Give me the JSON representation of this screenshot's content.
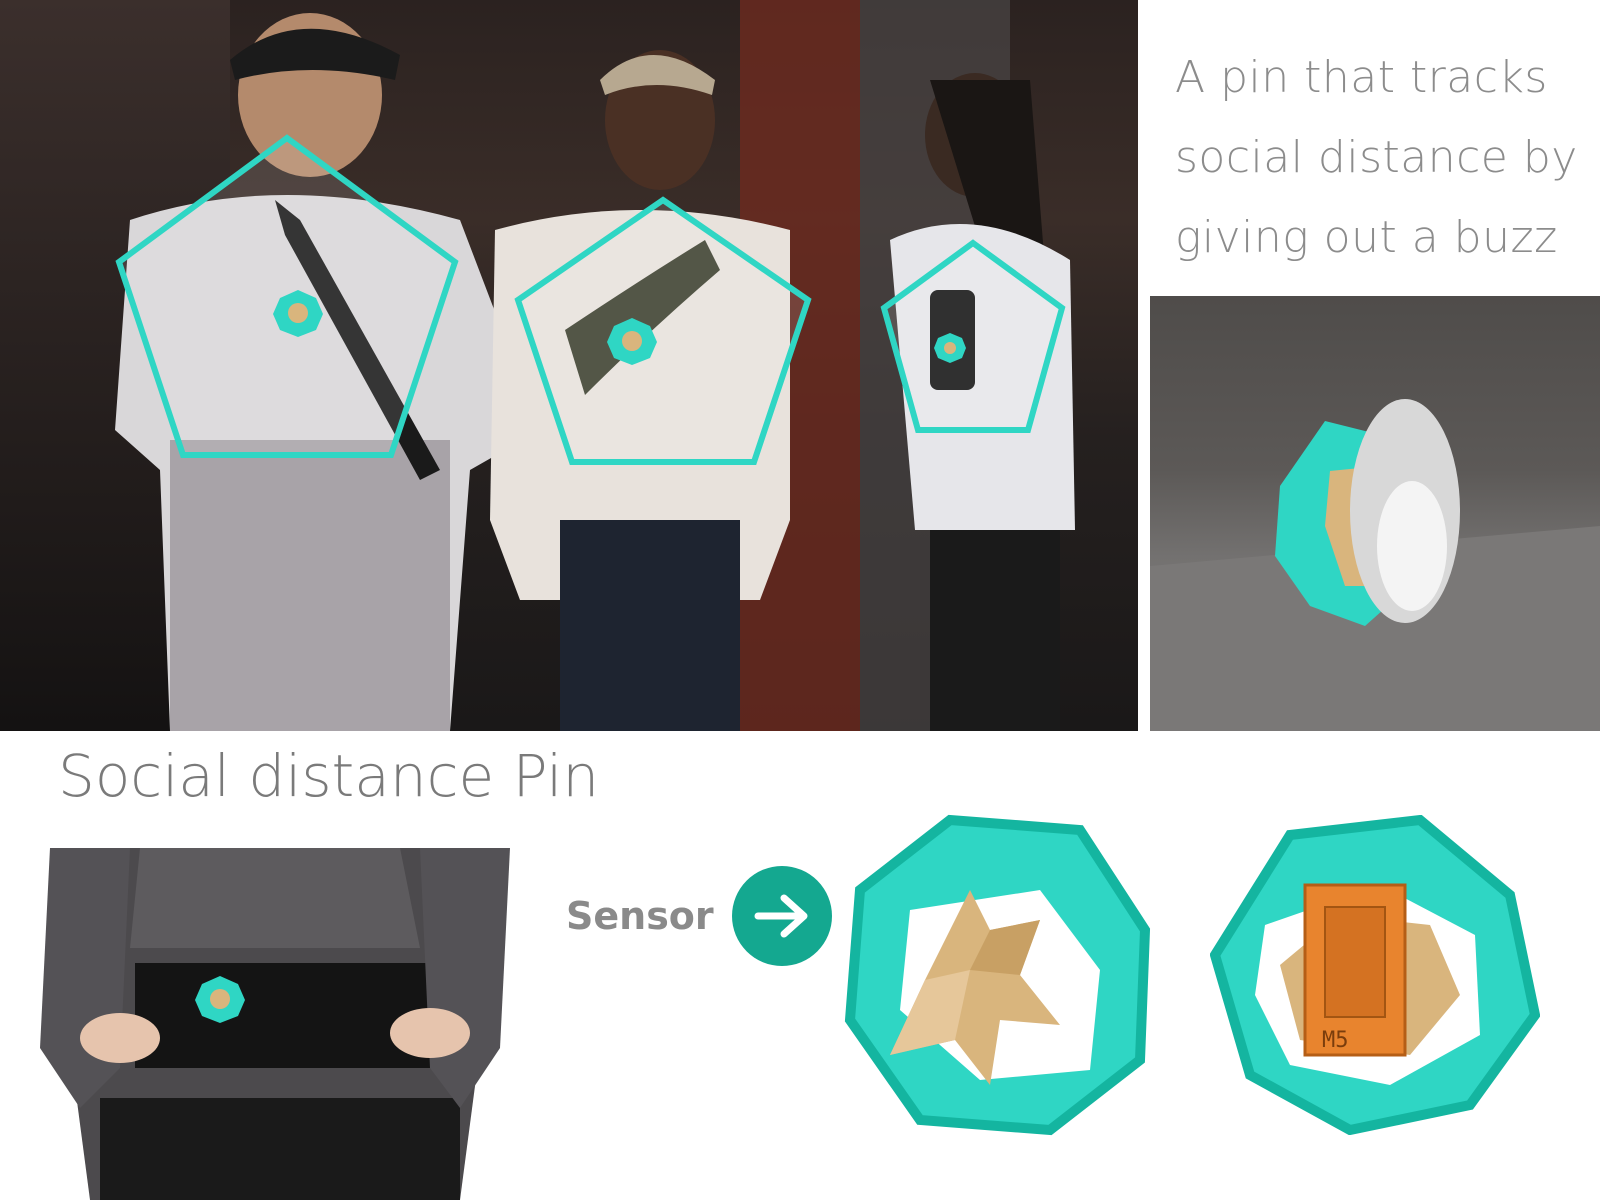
{
  "tagline_lines": [
    "A pin that tracks",
    "social distance by",
    "giving out a buzz"
  ],
  "title": "Social distance Pin",
  "sensor_label": "Sensor",
  "module_label": "M5",
  "colors": {
    "accent": "#2fd6c4",
    "accent_dark": "#14a890",
    "text_grey": "#8c8c8c",
    "gold": "#d9b57d",
    "orange": "#e8842e"
  },
  "icons": {
    "arrow": "arrow-right-icon"
  }
}
